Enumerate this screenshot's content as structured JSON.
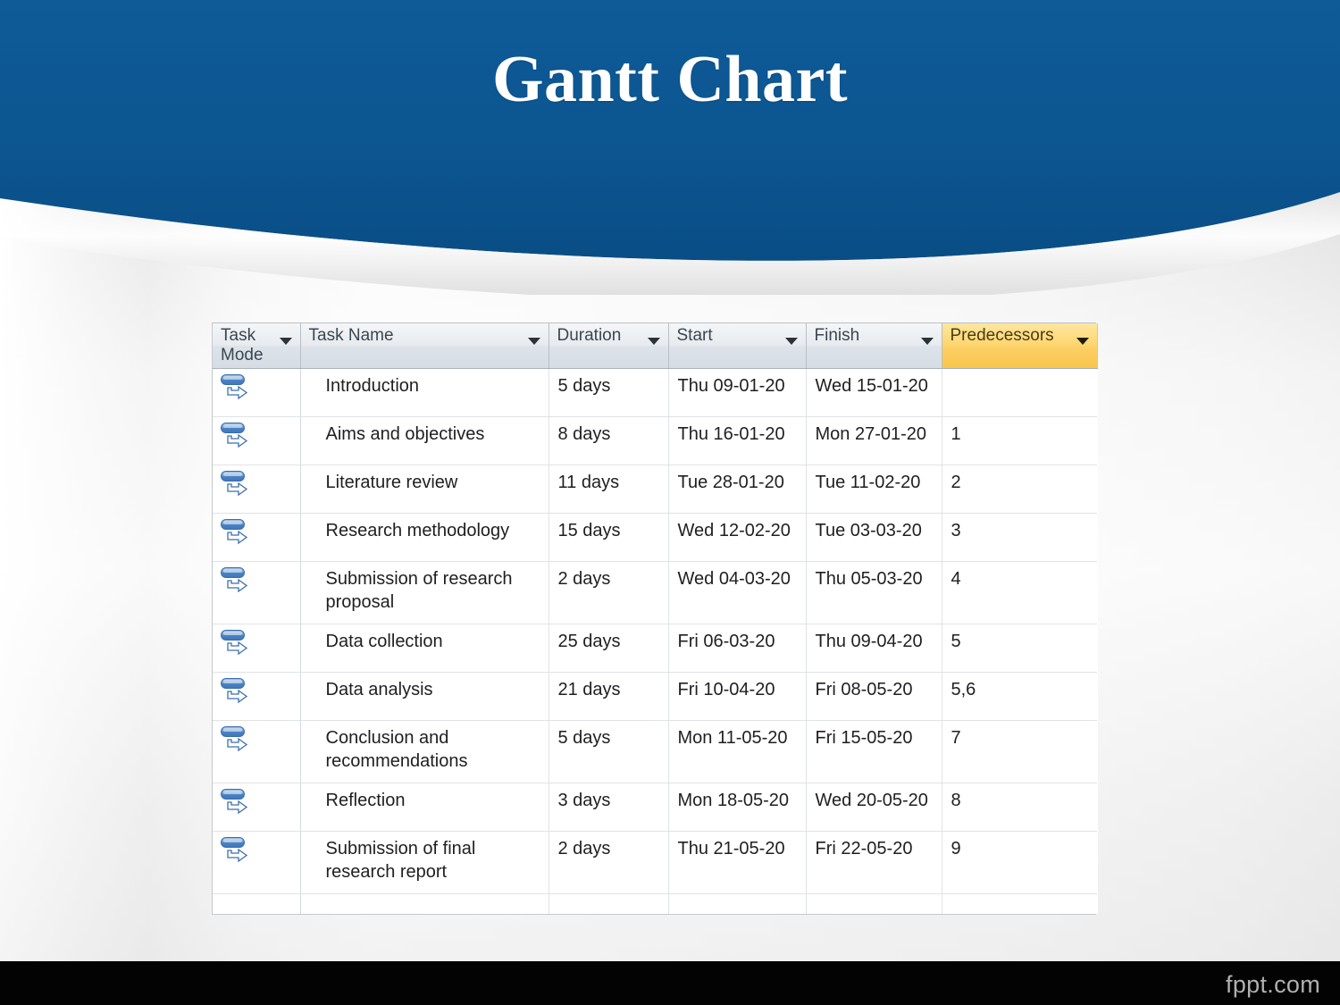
{
  "slide": {
    "title": "Gantt Chart",
    "header_color": "#0c5590",
    "footer_bar_color": "#030303",
    "watermark": "fppt.com"
  },
  "table": {
    "columns": [
      {
        "key": "mode",
        "label": "Task Mode",
        "highlight": false
      },
      {
        "key": "name",
        "label": "Task Name",
        "highlight": false
      },
      {
        "key": "dur",
        "label": "Duration",
        "highlight": false
      },
      {
        "key": "start",
        "label": "Start",
        "highlight": false
      },
      {
        "key": "finish",
        "label": "Finish",
        "highlight": false
      },
      {
        "key": "pred",
        "label": "Predecessors",
        "highlight": true
      }
    ],
    "highlight_color": "#fcd066",
    "mode_icon": "auto-schedule-icon",
    "rows": [
      {
        "mode_icon": "auto-schedule-icon",
        "name": "Introduction",
        "dur": "5 days",
        "start": "Thu 09-01-20",
        "finish": "Wed 15-01-20",
        "pred": ""
      },
      {
        "mode_icon": "auto-schedule-icon",
        "name": "Aims and objectives",
        "dur": "8 days",
        "start": "Thu 16-01-20",
        "finish": "Mon 27-01-20",
        "pred": "1"
      },
      {
        "mode_icon": "auto-schedule-icon",
        "name": "Literature review",
        "dur": "11 days",
        "start": "Tue 28-01-20",
        "finish": "Tue 11-02-20",
        "pred": "2"
      },
      {
        "mode_icon": "auto-schedule-icon",
        "name": "Research methodology",
        "dur": "15 days",
        "start": "Wed 12-02-20",
        "finish": "Tue 03-03-20",
        "pred": "3"
      },
      {
        "mode_icon": "auto-schedule-icon",
        "name": "Submission of research proposal",
        "dur": "2 days",
        "start": "Wed 04-03-20",
        "finish": "Thu 05-03-20",
        "pred": "4"
      },
      {
        "mode_icon": "auto-schedule-icon",
        "name": "Data collection",
        "dur": "25 days",
        "start": "Fri 06-03-20",
        "finish": "Thu 09-04-20",
        "pred": "5"
      },
      {
        "mode_icon": "auto-schedule-icon",
        "name": "Data analysis",
        "dur": "21 days",
        "start": "Fri 10-04-20",
        "finish": "Fri 08-05-20",
        "pred": "5,6"
      },
      {
        "mode_icon": "auto-schedule-icon",
        "name": "Conclusion and recommendations",
        "dur": "5 days",
        "start": "Mon 11-05-20",
        "finish": "Fri 15-05-20",
        "pred": "7"
      },
      {
        "mode_icon": "auto-schedule-icon",
        "name": "Reflection",
        "dur": "3 days",
        "start": "Mon 18-05-20",
        "finish": "Wed 20-05-20",
        "pred": "8"
      },
      {
        "mode_icon": "auto-schedule-icon",
        "name": "Submission of final research report",
        "dur": "2 days",
        "start": "Thu 21-05-20",
        "finish": "Fri 22-05-20",
        "pred": "9"
      }
    ],
    "tall_rows": [
      4,
      7,
      9
    ]
  },
  "chart_data": {
    "type": "table",
    "title": "Gantt Chart",
    "columns": [
      "Task Mode",
      "Task Name",
      "Duration",
      "Start",
      "Finish",
      "Predecessors"
    ],
    "rows": [
      [
        "auto-schedule-icon",
        "Introduction",
        "5 days",
        "Thu 09-01-20",
        "Wed 15-01-20",
        ""
      ],
      [
        "auto-schedule-icon",
        "Aims and objectives",
        "8 days",
        "Thu 16-01-20",
        "Mon 27-01-20",
        "1"
      ],
      [
        "auto-schedule-icon",
        "Literature review",
        "11 days",
        "Tue 28-01-20",
        "Tue 11-02-20",
        "2"
      ],
      [
        "auto-schedule-icon",
        "Research methodology",
        "15 days",
        "Wed 12-02-20",
        "Tue 03-03-20",
        "3"
      ],
      [
        "auto-schedule-icon",
        "Submission of research proposal",
        "2 days",
        "Wed 04-03-20",
        "Thu 05-03-20",
        "4"
      ],
      [
        "auto-schedule-icon",
        "Data collection",
        "25 days",
        "Fri 06-03-20",
        "Thu 09-04-20",
        "5"
      ],
      [
        "auto-schedule-icon",
        "Data analysis",
        "21 days",
        "Fri 10-04-20",
        "Fri 08-05-20",
        "5,6"
      ],
      [
        "auto-schedule-icon",
        "Conclusion and recommendations",
        "5 days",
        "Mon 11-05-20",
        "Fri 15-05-20",
        "7"
      ],
      [
        "auto-schedule-icon",
        "Reflection",
        "3 days",
        "Mon 18-05-20",
        "Wed 20-05-20",
        "8"
      ],
      [
        "auto-schedule-icon",
        "Submission of final research report",
        "2 days",
        "Thu 21-05-20",
        "Fri 22-05-20",
        "9"
      ]
    ],
    "durations_days": [
      5,
      8,
      11,
      15,
      2,
      25,
      21,
      5,
      3,
      2
    ],
    "predecessors": [
      null,
      "1",
      "2",
      "3",
      "4",
      "5",
      "5,6",
      "7",
      "8",
      "9"
    ]
  }
}
